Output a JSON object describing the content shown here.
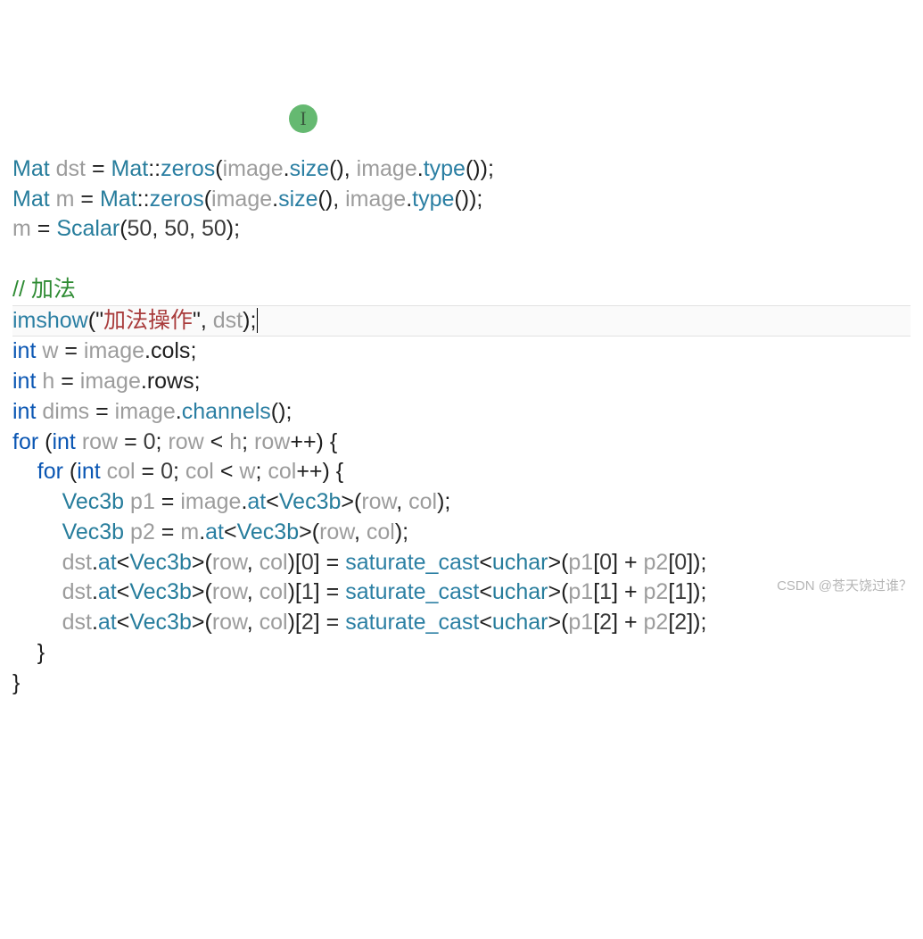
{
  "code": {
    "l0": {
      "Mat": "Mat",
      "sp": " ",
      "dst": "dst",
      "eq": " = ",
      "Mat2": "Mat",
      "cc": "::",
      "zeros": "zeros",
      "lp": "(",
      "image1": "image",
      "dot1": ".",
      "size": "size",
      "call1": "()",
      "comma": ", ",
      "image2": "image",
      "dot2": ".",
      "type": "type",
      "call2": "()",
      "rp": ")",
      "semi": ";"
    },
    "l1": {
      "Mat": "Mat",
      "sp": " ",
      "m": "m",
      "eq": " = ",
      "Mat2": "Mat",
      "cc": "::",
      "zeros": "zeros",
      "lp": "(",
      "image1": "image",
      "dot1": ".",
      "size": "size",
      "call1": "()",
      "comma": ", ",
      "image2": "image",
      "dot2": ".",
      "type": "type",
      "call2": "()",
      "rp": ")",
      "semi": ";"
    },
    "l2": {
      "m": "m",
      "eq": " = ",
      "Scalar": "Scalar",
      "lp": "(",
      "n1": "50",
      "c1": ", ",
      "n2": "50",
      "c2": ", ",
      "n3": "50",
      "rp": ")",
      "semi": ";"
    },
    "l4": {
      "comment": "// 加法"
    },
    "l5": {
      "imshow": "imshow",
      "lp": "(",
      "q1": "\"",
      "str": "加法操作",
      "q2": "\"",
      "comma": ", ",
      "dst": "dst",
      "rp": ")",
      "semi": ";"
    },
    "l6": {
      "int": "int",
      "sp": " ",
      "w": "w",
      "eq": " = ",
      "image": "image",
      "dot": ".",
      "cols": "cols",
      "semi": ";"
    },
    "l7": {
      "int": "int",
      "sp": " ",
      "h": "h",
      "eq": " = ",
      "image": "image",
      "dot": ".",
      "rows": "rows",
      "semi": ";"
    },
    "l8": {
      "int": "int",
      "sp": " ",
      "dims": "dims",
      "eq": " = ",
      "image": "image",
      "dot": ".",
      "channels": "channels",
      "call": "()",
      "semi": ";"
    },
    "l9": {
      "for": "for",
      "sp": " (",
      "int": "int",
      "sp2": " ",
      "row": "row",
      "eq": " = ",
      "zero": "0",
      "semi": "; ",
      "row2": "row",
      "lt": " < ",
      "h": "h",
      "semi2": "; ",
      "row3": "row",
      "inc": "++) {"
    },
    "l10": {
      "for": "for",
      "sp": " (",
      "int": "int",
      "sp2": " ",
      "col": "col",
      "eq": " = ",
      "zero": "0",
      "semi": "; ",
      "col2": "col",
      "lt": " < ",
      "w": "w",
      "semi2": "; ",
      "col3": "col",
      "inc": "++) {"
    },
    "l11": {
      "Vec3b": "Vec3b",
      "sp": " ",
      "p1": "p1",
      "eq": " = ",
      "image": "image",
      "dot": ".",
      "at": "at",
      "lt": "<",
      "Vec3b2": "Vec3b",
      "gt": ">(",
      "row": "row",
      "c": ", ",
      "col": "col",
      "rp": ");"
    },
    "l12": {
      "Vec3b": "Vec3b",
      "sp": " ",
      "p2": "p2",
      "eq": " = ",
      "m": "m",
      "dot": ".",
      "at": "at",
      "lt": "<",
      "Vec3b2": "Vec3b",
      "gt": ">(",
      "row": "row",
      "c": ", ",
      "col": "col",
      "rp": ");"
    },
    "l13": {
      "dst": "dst",
      "dot": ".",
      "at": "at",
      "lt": "<",
      "Vec3b": "Vec3b",
      "gt": ">(",
      "row": "row",
      "c": ", ",
      "col": "col",
      "rp": ")[",
      "idx": "0",
      "rb": "] = ",
      "sat": "saturate_cast",
      "lt2": "<",
      "uchar": "uchar",
      "gt2": ">(",
      "p1": "p1",
      "lb1": "[",
      "i1": "0",
      "rb1": "] + ",
      "p2": "p2",
      "lb2": "[",
      "i2": "0",
      "rb2": "]);"
    },
    "l14": {
      "dst": "dst",
      "dot": ".",
      "at": "at",
      "lt": "<",
      "Vec3b": "Vec3b",
      "gt": ">(",
      "row": "row",
      "c": ", ",
      "col": "col",
      "rp": ")[",
      "idx": "1",
      "rb": "] = ",
      "sat": "saturate_cast",
      "lt2": "<",
      "uchar": "uchar",
      "gt2": ">(",
      "p1": "p1",
      "lb1": "[",
      "i1": "1",
      "rb1": "] + ",
      "p2": "p2",
      "lb2": "[",
      "i2": "1",
      "rb2": "]);"
    },
    "l15": {
      "dst": "dst",
      "dot": ".",
      "at": "at",
      "lt": "<",
      "Vec3b": "Vec3b",
      "gt": ">(",
      "row": "row",
      "c": ", ",
      "col": "col",
      "rp": ")[",
      "idx": "2",
      "rb": "] = ",
      "sat": "saturate_cast",
      "lt2": "<",
      "uchar": "uchar",
      "gt2": ">(",
      "p1": "p1",
      "lb1": "[",
      "i1": "2",
      "rb1": "] + ",
      "p2": "p2",
      "lb2": "[",
      "i2": "2",
      "rb2": "]);"
    },
    "l16": {
      "brace": "}"
    },
    "l17": {
      "brace": "}"
    }
  },
  "cursor_glyph": "I",
  "watermark": "CSDN @苍天饶过谁？"
}
